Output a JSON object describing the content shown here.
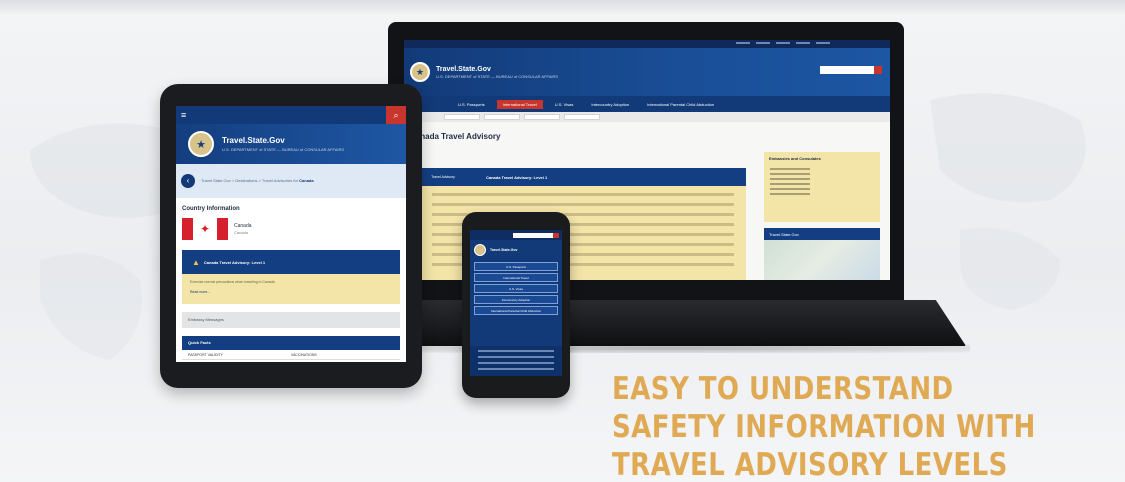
{
  "brand": {
    "site_name": "Travel.State.Gov",
    "site_tagline": "U.S. DEPARTMENT of STATE — BUREAU of CONSULAR AFFAIRS",
    "navy": "#123a78",
    "accent_red": "#c8352c",
    "advisory_yellow": "#f3e4a8",
    "headline_gold": "#e0aa55"
  },
  "laptop": {
    "nav_items": [
      "U.S. Passports",
      "International Travel",
      "U.S. Visas",
      "Intercountry Adoption",
      "International Parental Child Abduction"
    ],
    "active_nav_index": 1,
    "page_title": "Canada Travel Advisory",
    "advisory_level": "Travel Advisory",
    "advisory_label": "Canada Travel Advisory: Level 1",
    "sidebar_title": "Embassies and Consulates",
    "sidebar_map_title": "Travel.State.Gov"
  },
  "tablet": {
    "notice_text": "Travel.State.Gov > Destinations > Travel Advisories for",
    "notice_country": "Canada",
    "section_title": "Country Information",
    "country_name": "Canada",
    "country_sub": "Canada",
    "advisory_label": "Canada Travel Advisory: Level 1",
    "advisory_body": "Exercise normal precautions when traveling in Canada",
    "advisory_more": "Read more...",
    "contact_label": "Embassy Messages",
    "table_title": "Quick Facts",
    "table_cols": [
      "PASSPORT VALIDITY",
      "VACCINATIONS"
    ]
  },
  "phone": {
    "brand": "Travel.State.Gov",
    "menu_items": [
      "U.S. Passports",
      "International Travel",
      "U.S. Visas",
      "Intercountry Adoption",
      "International Parental Child Abduction"
    ]
  },
  "headline": {
    "line1": "EASY TO UNDERSTAND",
    "line2": "SAFETY INFORMATION WITH",
    "line3": "TRAVEL ADVISORY LEVELS"
  }
}
